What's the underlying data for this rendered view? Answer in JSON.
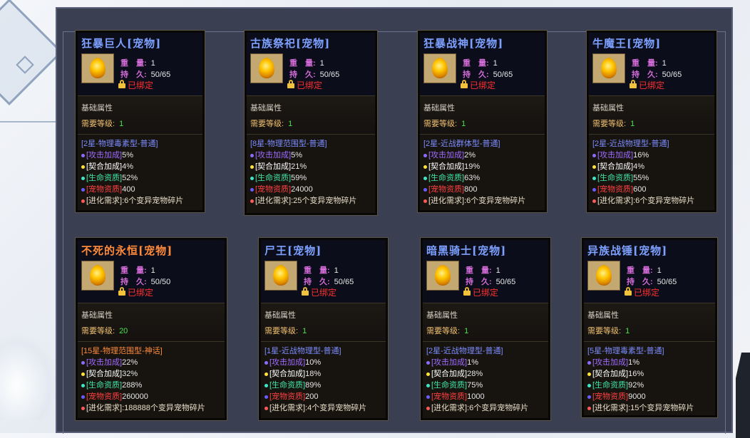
{
  "labels": {
    "weight": "重　量:",
    "durability": "持　久:",
    "bound": "已绑定",
    "base_attrs": "基础属性",
    "req_level": "需要等级:",
    "attack": "[攻击加成]",
    "contract": "[契合加成]",
    "life": "[生命资质]",
    "pet_quality": "[宠物资质]",
    "evolve": "[进化需求]:"
  },
  "cards": [
    {
      "name": "狂暴巨人[宠物]",
      "weight": "1",
      "durability": "50/65",
      "level": "1",
      "type": "[2星-物理毒素型-普通]",
      "attack": "5%",
      "contract": "4%",
      "life": "52%",
      "quality": "400",
      "evolve": "6个变异宠物碎片"
    },
    {
      "name": "古族祭祀[宠物]",
      "weight": "1",
      "durability": "50/65",
      "level": "1",
      "type": "[8星-物理范围型-普通]",
      "attack": "5%",
      "contract": "21%",
      "life": "59%",
      "quality": "24000",
      "evolve": "25个变异宠物碎片"
    },
    {
      "name": "狂暴战神[宠物]",
      "weight": "1",
      "durability": "50/65",
      "level": "1",
      "type": "[2星-近战群体型-普通]",
      "attack": "2%",
      "contract": "19%",
      "life": "63%",
      "quality": "800",
      "evolve": "6个变异宠物碎片"
    },
    {
      "name": "牛魔王[宠物]",
      "weight": "1",
      "durability": "50/65",
      "level": "1",
      "type": "[2星-近战物理型-普通]",
      "attack": "16%",
      "contract": "4%",
      "life": "55%",
      "quality": "600",
      "evolve": "6个变异宠物碎片"
    },
    {
      "name": "不死的永恒[宠物]",
      "weight": "1",
      "durability": "50/50",
      "level": "20",
      "type": "[15星-物理范围型-神话]",
      "attack": "22%",
      "contract": "32%",
      "life": "288%",
      "quality": "260000",
      "evolve": "188888个变异宠物碎片"
    },
    {
      "name": "尸王[宠物]",
      "weight": "1",
      "durability": "50/65",
      "level": "1",
      "type": "[1星-近战物理型-普通]",
      "attack": "10%",
      "contract": "18%",
      "life": "89%",
      "quality": "200",
      "evolve": "4个变异宠物碎片"
    },
    {
      "name": "暗黑骑士[宠物]",
      "weight": "1",
      "durability": "50/65",
      "level": "1",
      "type": "[2星-近战物理型-普通]",
      "attack": "1%",
      "contract": "28%",
      "life": "75%",
      "quality": "1000",
      "evolve": "6个变异宠物碎片"
    },
    {
      "name": "异族战锤[宠物]",
      "weight": "1",
      "durability": "50/65",
      "level": "1",
      "type": "[5星-物理毒素型-普通]",
      "attack": "1%",
      "contract": "16%",
      "life": "92%",
      "quality": "9000",
      "evolve": "15个变异宠物碎片"
    }
  ]
}
